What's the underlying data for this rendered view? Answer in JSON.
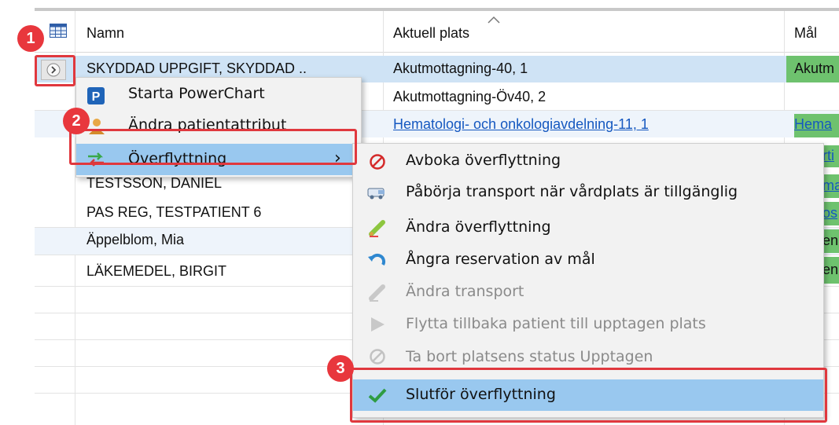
{
  "grid": {
    "headers": {
      "name": "Namn",
      "current_location": "Aktuell plats",
      "target": "Mål"
    },
    "rows": [
      {
        "name": "SKYDDAD UPPGIFT, SKYDDAD ..",
        "location": "Akutmottagning-40, 1",
        "target": "Akutm"
      },
      {
        "name": "",
        "location": "Akutmottagning-Öv40, 2",
        "target": ""
      },
      {
        "name": "",
        "location": "Hematologi- och onkologiavdelning-11, 1",
        "target": "Hema"
      },
      {
        "name": "TESTSSON, DANIEL",
        "location": "",
        "target": "rti"
      },
      {
        "name": "",
        "location": "",
        "target": "ma"
      },
      {
        "name": "PAS REG, TESTPATIENT 6",
        "location": "",
        "target": "os"
      },
      {
        "name": "Äppelblom, Mia",
        "location": "",
        "target": "en"
      },
      {
        "name": "LÄKEMEDEL, BIRGIT",
        "location": "",
        "target": "en"
      }
    ]
  },
  "context_menu": {
    "items": [
      {
        "label": "Starta PowerChart",
        "icon": "powerchart-icon"
      },
      {
        "label": "Ändra patientattribut",
        "icon": "patient-attribute-icon"
      },
      {
        "label": "Överflyttning",
        "icon": "transfer-icon",
        "arrow": "›"
      }
    ]
  },
  "submenu": {
    "items": [
      {
        "label": "Avboka överflyttning",
        "icon": "cancel-icon",
        "enabled": true
      },
      {
        "label": "Påbörja transport när vårdplats är tillgänglig",
        "icon": "ambulance-icon",
        "enabled": true
      },
      {
        "label": "Ändra överflyttning",
        "icon": "pencil-icon",
        "enabled": true
      },
      {
        "label": "Ångra reservation av mål",
        "icon": "undo-icon",
        "enabled": true
      },
      {
        "label": "Ändra transport",
        "icon": "pencil-disabled-icon",
        "enabled": false
      },
      {
        "label": "Flytta tillbaka patient till upptagen plats",
        "icon": "play-icon",
        "enabled": false
      },
      {
        "label": "Ta bort platsens status Upptagen",
        "icon": "cancel-disabled-icon",
        "enabled": false
      },
      {
        "label": "Slutför överflyttning",
        "icon": "checkmark-icon",
        "enabled": true
      }
    ]
  },
  "callouts": {
    "one": "1",
    "two": "2",
    "three": "3"
  },
  "colors": {
    "highlight": "#99c8ef",
    "callout_red": "#e0383e",
    "target_green": "#6ec26e",
    "link_blue": "#1558c0"
  }
}
